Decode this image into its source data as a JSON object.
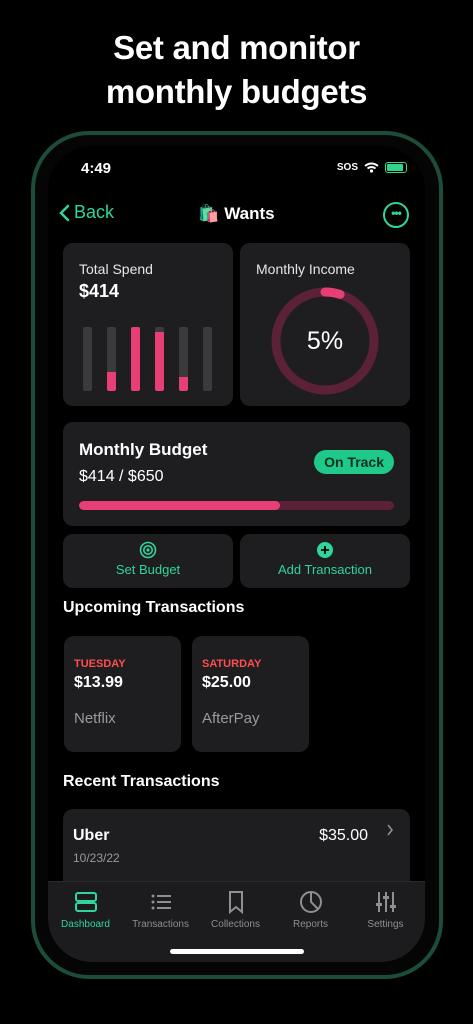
{
  "headline": {
    "line1": "Set and monitor",
    "line2": "monthly budgets"
  },
  "status": {
    "time": "4:49",
    "carrier": "SOS"
  },
  "nav": {
    "back": "Back",
    "emoji": "🛍️",
    "title": "Wants"
  },
  "spend": {
    "label": "Total Spend",
    "value": "$414",
    "bar_levels": [
      0,
      0.3,
      1,
      0.92,
      0.22,
      0
    ]
  },
  "income": {
    "label": "Monthly Income",
    "percent": "5%",
    "fraction": 0.05
  },
  "budget": {
    "label": "Monthly Budget",
    "amount": "$414 / $650",
    "status": "On Track",
    "progress": 0.637
  },
  "actions": {
    "set_budget": "Set Budget",
    "add_transaction": "Add Transaction"
  },
  "upcoming": {
    "title": "Upcoming Transactions",
    "items": [
      {
        "day": "TUESDAY",
        "amount": "$13.99",
        "merchant": "Netflix"
      },
      {
        "day": "SATURDAY",
        "amount": "$25.00",
        "merchant": "AfterPay"
      }
    ]
  },
  "recent": {
    "title": "Recent Transactions",
    "items": [
      {
        "merchant": "Uber",
        "date": "10/23/22",
        "amount": "$35.00"
      }
    ]
  },
  "tabs": [
    {
      "label": "Dashboard",
      "icon": "dashboard-icon",
      "active": true
    },
    {
      "label": "Transactions",
      "icon": "list-icon"
    },
    {
      "label": "Collections",
      "icon": "bookmark-icon"
    },
    {
      "label": "Reports",
      "icon": "pie-chart-icon"
    },
    {
      "label": "Settings",
      "icon": "sliders-icon"
    }
  ],
  "colors": {
    "accent": "#2fd59a",
    "pink": "#e83e76",
    "phone_frame": "#1c4d38"
  }
}
